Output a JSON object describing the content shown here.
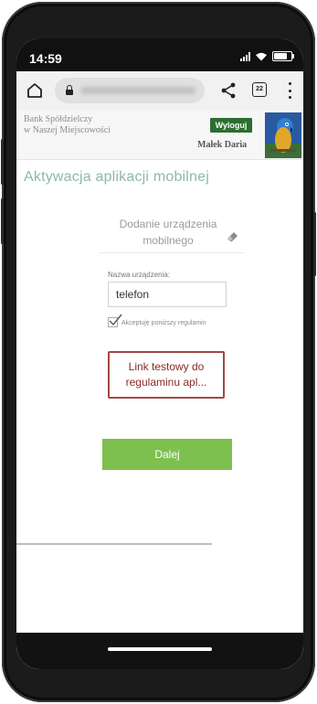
{
  "status_bar": {
    "time": "14:59"
  },
  "browser": {
    "home_icon": "home-icon",
    "tabs_count": "22"
  },
  "header": {
    "bank_name_line1": "Bank Spółdzielczy",
    "bank_name_line2": "w Naszej Miejscowości",
    "logout_label": "Wyloguj",
    "user_name": "Małek Daria"
  },
  "main": {
    "title": "Aktywacja aplikacji mobilnej",
    "section_title": "Dodanie urządzenia mobilnego",
    "device_name_label": "Nazwa urządzenia:",
    "device_name_value": "telefon",
    "accept_label": "Akceptuję poniższy regulamin",
    "accept_checked": true,
    "terms_link_label": "Link testowy do regulaminu apl...",
    "next_button_label": "Dalej"
  },
  "colors": {
    "accent_green": "#7ec04e",
    "logout_green": "#2b6e2f",
    "title_teal": "#8fb8ad",
    "link_red": "#a24844"
  }
}
